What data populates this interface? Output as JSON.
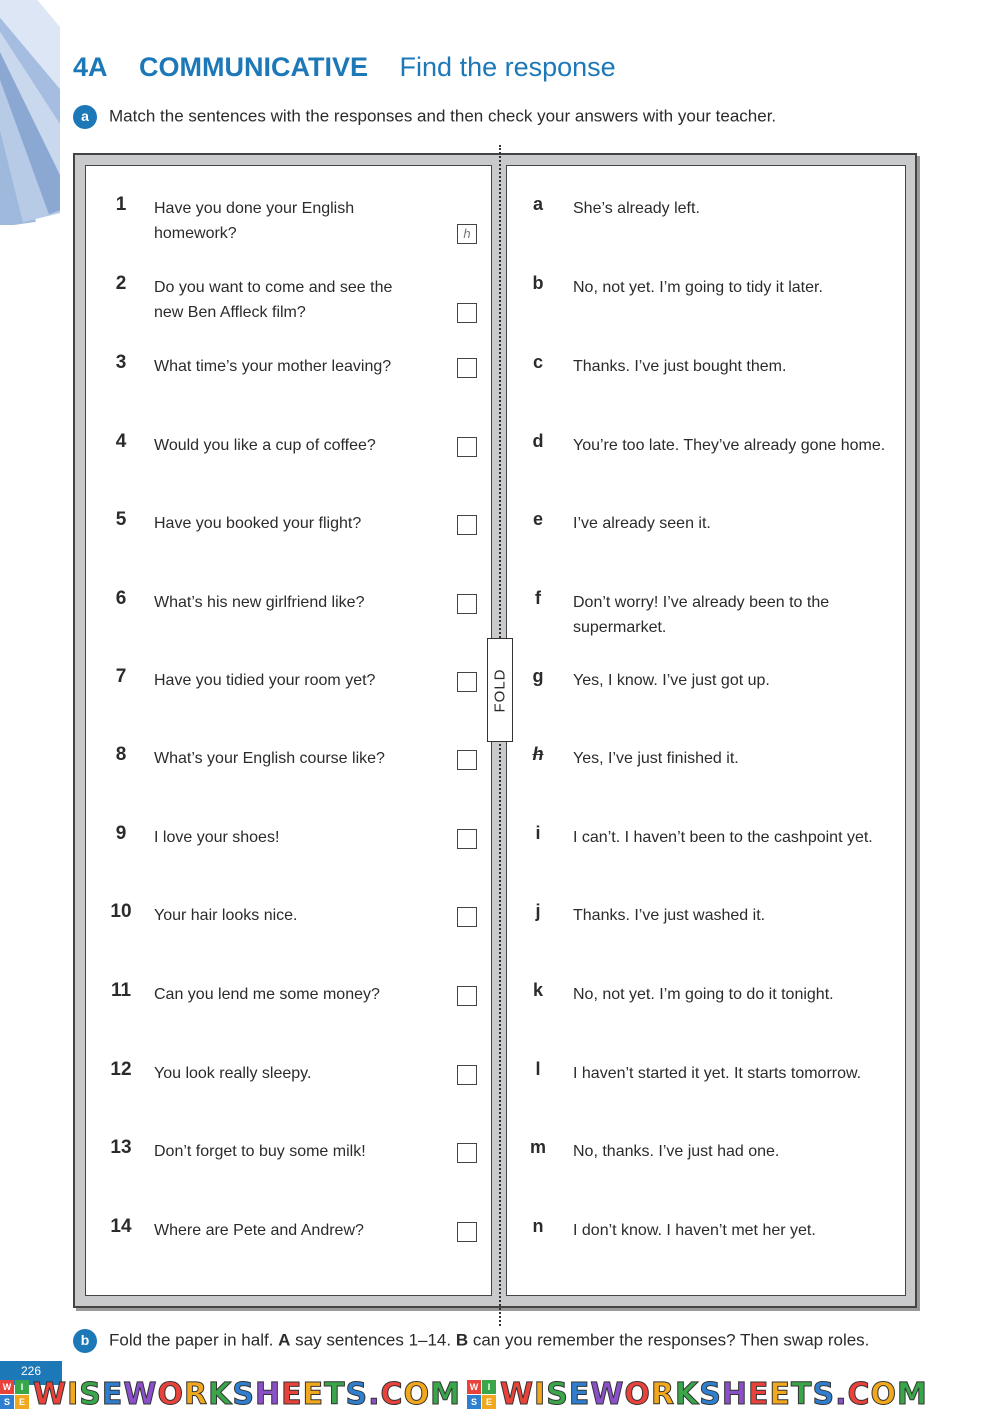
{
  "header": {
    "unit": "4A",
    "kind": "COMMUNICATIVE",
    "subtitle": "Find the response"
  },
  "instructions": {
    "a": {
      "badge": "a",
      "text": "Match the sentences with the responses and then check your answers with your teacher."
    },
    "b": {
      "badge": "b",
      "text_1": "Fold the paper in half. ",
      "bold_1": "A",
      "text_2": " say sentences 1–14. ",
      "bold_2": "B",
      "text_3": " can you remember the responses? Then swap roles."
    }
  },
  "fold_label": "FOLD",
  "sentences": [
    {
      "num": "1",
      "text": "Have you done your English homework?",
      "answer": "h"
    },
    {
      "num": "2",
      "text": "Do you want to come and see the new Ben Affleck film?",
      "answer": ""
    },
    {
      "num": "3",
      "text": "What time’s your mother leaving?",
      "answer": ""
    },
    {
      "num": "4",
      "text": "Would you like a cup of coffee?",
      "answer": ""
    },
    {
      "num": "5",
      "text": "Have you booked your flight?",
      "answer": ""
    },
    {
      "num": "6",
      "text": "What’s his new girlfriend like?",
      "answer": ""
    },
    {
      "num": "7",
      "text": "Have you tidied your room yet?",
      "answer": ""
    },
    {
      "num": "8",
      "text": "What’s your English course like?",
      "answer": ""
    },
    {
      "num": "9",
      "text": "I love your shoes!",
      "answer": ""
    },
    {
      "num": "10",
      "text": "Your hair looks nice.",
      "answer": ""
    },
    {
      "num": "11",
      "text": "Can you lend me some money?",
      "answer": ""
    },
    {
      "num": "12",
      "text": "You look really sleepy.",
      "answer": ""
    },
    {
      "num": "13",
      "text": "Don’t forget to buy some milk!",
      "answer": ""
    },
    {
      "num": "14",
      "text": "Where are Pete and Andrew?",
      "answer": ""
    }
  ],
  "responses": [
    {
      "letter": "a",
      "text": "She’s already left.",
      "crossed": false
    },
    {
      "letter": "b",
      "text": "No, not yet. I’m going to tidy it later.",
      "crossed": false
    },
    {
      "letter": "c",
      "text": "Thanks. I’ve just bought them.",
      "crossed": false
    },
    {
      "letter": "d",
      "text": "You’re too late. They’ve already gone home.",
      "crossed": false
    },
    {
      "letter": "e",
      "text": "I’ve already seen it.",
      "crossed": false
    },
    {
      "letter": "f",
      "text": "Don’t worry! I’ve already been to the supermarket.",
      "crossed": false
    },
    {
      "letter": "g",
      "text": "Yes, I know. I’ve just got up.",
      "crossed": false
    },
    {
      "letter": "h",
      "text": "Yes, I’ve just finished it.",
      "crossed": true
    },
    {
      "letter": "i",
      "text": "I can’t. I haven’t been to the cashpoint yet.",
      "crossed": false
    },
    {
      "letter": "j",
      "text": "Thanks. I’ve just washed it.",
      "crossed": false
    },
    {
      "letter": "k",
      "text": "No, not yet. I’m going to do it tonight.",
      "crossed": false
    },
    {
      "letter": "l",
      "text": "I haven’t started it yet. It starts tomorrow.",
      "crossed": false
    },
    {
      "letter": "m",
      "text": "No, thanks. I’ve just had one.",
      "crossed": false
    },
    {
      "letter": "n",
      "text": "I don’t know. I haven’t met her yet.",
      "crossed": false
    }
  ],
  "page_number": "226",
  "watermark": {
    "text": "WISEWORKSHEETS.COM",
    "logo_letters": [
      "W",
      "I",
      "S",
      "E"
    ],
    "logo_colors": [
      "#e8423a",
      "#3aa64a",
      "#2f7fd0",
      "#f2a81d"
    ]
  },
  "colors": {
    "accent": "#1d78b8",
    "frame_gray": "#c8cacb"
  }
}
